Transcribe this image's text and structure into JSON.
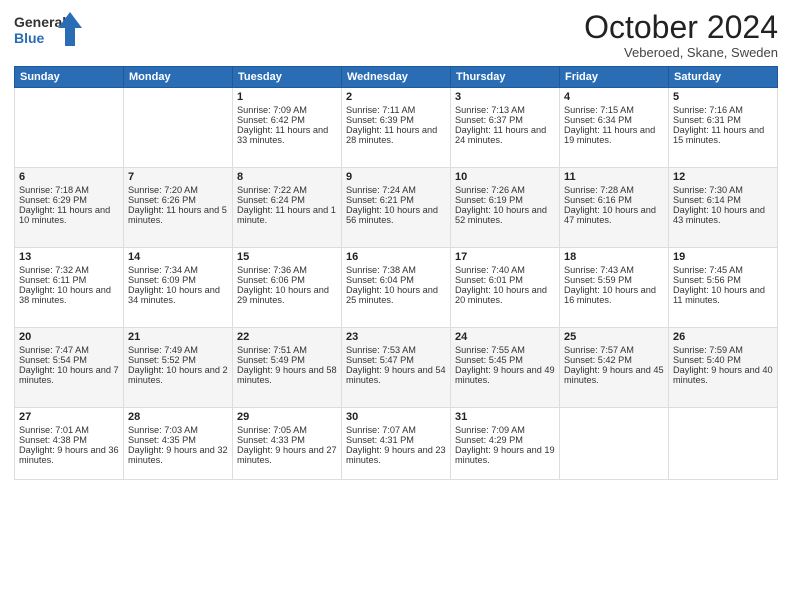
{
  "header": {
    "logo_general": "General",
    "logo_blue": "Blue",
    "month_title": "October 2024",
    "location": "Veberoed, Skane, Sweden"
  },
  "days_of_week": [
    "Sunday",
    "Monday",
    "Tuesday",
    "Wednesday",
    "Thursday",
    "Friday",
    "Saturday"
  ],
  "weeks": [
    [
      {
        "day": "",
        "sunrise": "",
        "sunset": "",
        "daylight": ""
      },
      {
        "day": "",
        "sunrise": "",
        "sunset": "",
        "daylight": ""
      },
      {
        "day": "1",
        "sunrise": "Sunrise: 7:09 AM",
        "sunset": "Sunset: 6:42 PM",
        "daylight": "Daylight: 11 hours and 33 minutes."
      },
      {
        "day": "2",
        "sunrise": "Sunrise: 7:11 AM",
        "sunset": "Sunset: 6:39 PM",
        "daylight": "Daylight: 11 hours and 28 minutes."
      },
      {
        "day": "3",
        "sunrise": "Sunrise: 7:13 AM",
        "sunset": "Sunset: 6:37 PM",
        "daylight": "Daylight: 11 hours and 24 minutes."
      },
      {
        "day": "4",
        "sunrise": "Sunrise: 7:15 AM",
        "sunset": "Sunset: 6:34 PM",
        "daylight": "Daylight: 11 hours and 19 minutes."
      },
      {
        "day": "5",
        "sunrise": "Sunrise: 7:16 AM",
        "sunset": "Sunset: 6:31 PM",
        "daylight": "Daylight: 11 hours and 15 minutes."
      }
    ],
    [
      {
        "day": "6",
        "sunrise": "Sunrise: 7:18 AM",
        "sunset": "Sunset: 6:29 PM",
        "daylight": "Daylight: 11 hours and 10 minutes."
      },
      {
        "day": "7",
        "sunrise": "Sunrise: 7:20 AM",
        "sunset": "Sunset: 6:26 PM",
        "daylight": "Daylight: 11 hours and 5 minutes."
      },
      {
        "day": "8",
        "sunrise": "Sunrise: 7:22 AM",
        "sunset": "Sunset: 6:24 PM",
        "daylight": "Daylight: 11 hours and 1 minute."
      },
      {
        "day": "9",
        "sunrise": "Sunrise: 7:24 AM",
        "sunset": "Sunset: 6:21 PM",
        "daylight": "Daylight: 10 hours and 56 minutes."
      },
      {
        "day": "10",
        "sunrise": "Sunrise: 7:26 AM",
        "sunset": "Sunset: 6:19 PM",
        "daylight": "Daylight: 10 hours and 52 minutes."
      },
      {
        "day": "11",
        "sunrise": "Sunrise: 7:28 AM",
        "sunset": "Sunset: 6:16 PM",
        "daylight": "Daylight: 10 hours and 47 minutes."
      },
      {
        "day": "12",
        "sunrise": "Sunrise: 7:30 AM",
        "sunset": "Sunset: 6:14 PM",
        "daylight": "Daylight: 10 hours and 43 minutes."
      }
    ],
    [
      {
        "day": "13",
        "sunrise": "Sunrise: 7:32 AM",
        "sunset": "Sunset: 6:11 PM",
        "daylight": "Daylight: 10 hours and 38 minutes."
      },
      {
        "day": "14",
        "sunrise": "Sunrise: 7:34 AM",
        "sunset": "Sunset: 6:09 PM",
        "daylight": "Daylight: 10 hours and 34 minutes."
      },
      {
        "day": "15",
        "sunrise": "Sunrise: 7:36 AM",
        "sunset": "Sunset: 6:06 PM",
        "daylight": "Daylight: 10 hours and 29 minutes."
      },
      {
        "day": "16",
        "sunrise": "Sunrise: 7:38 AM",
        "sunset": "Sunset: 6:04 PM",
        "daylight": "Daylight: 10 hours and 25 minutes."
      },
      {
        "day": "17",
        "sunrise": "Sunrise: 7:40 AM",
        "sunset": "Sunset: 6:01 PM",
        "daylight": "Daylight: 10 hours and 20 minutes."
      },
      {
        "day": "18",
        "sunrise": "Sunrise: 7:43 AM",
        "sunset": "Sunset: 5:59 PM",
        "daylight": "Daylight: 10 hours and 16 minutes."
      },
      {
        "day": "19",
        "sunrise": "Sunrise: 7:45 AM",
        "sunset": "Sunset: 5:56 PM",
        "daylight": "Daylight: 10 hours and 11 minutes."
      }
    ],
    [
      {
        "day": "20",
        "sunrise": "Sunrise: 7:47 AM",
        "sunset": "Sunset: 5:54 PM",
        "daylight": "Daylight: 10 hours and 7 minutes."
      },
      {
        "day": "21",
        "sunrise": "Sunrise: 7:49 AM",
        "sunset": "Sunset: 5:52 PM",
        "daylight": "Daylight: 10 hours and 2 minutes."
      },
      {
        "day": "22",
        "sunrise": "Sunrise: 7:51 AM",
        "sunset": "Sunset: 5:49 PM",
        "daylight": "Daylight: 9 hours and 58 minutes."
      },
      {
        "day": "23",
        "sunrise": "Sunrise: 7:53 AM",
        "sunset": "Sunset: 5:47 PM",
        "daylight": "Daylight: 9 hours and 54 minutes."
      },
      {
        "day": "24",
        "sunrise": "Sunrise: 7:55 AM",
        "sunset": "Sunset: 5:45 PM",
        "daylight": "Daylight: 9 hours and 49 minutes."
      },
      {
        "day": "25",
        "sunrise": "Sunrise: 7:57 AM",
        "sunset": "Sunset: 5:42 PM",
        "daylight": "Daylight: 9 hours and 45 minutes."
      },
      {
        "day": "26",
        "sunrise": "Sunrise: 7:59 AM",
        "sunset": "Sunset: 5:40 PM",
        "daylight": "Daylight: 9 hours and 40 minutes."
      }
    ],
    [
      {
        "day": "27",
        "sunrise": "Sunrise: 7:01 AM",
        "sunset": "Sunset: 4:38 PM",
        "daylight": "Daylight: 9 hours and 36 minutes."
      },
      {
        "day": "28",
        "sunrise": "Sunrise: 7:03 AM",
        "sunset": "Sunset: 4:35 PM",
        "daylight": "Daylight: 9 hours and 32 minutes."
      },
      {
        "day": "29",
        "sunrise": "Sunrise: 7:05 AM",
        "sunset": "Sunset: 4:33 PM",
        "daylight": "Daylight: 9 hours and 27 minutes."
      },
      {
        "day": "30",
        "sunrise": "Sunrise: 7:07 AM",
        "sunset": "Sunset: 4:31 PM",
        "daylight": "Daylight: 9 hours and 23 minutes."
      },
      {
        "day": "31",
        "sunrise": "Sunrise: 7:09 AM",
        "sunset": "Sunset: 4:29 PM",
        "daylight": "Daylight: 9 hours and 19 minutes."
      },
      {
        "day": "",
        "sunrise": "",
        "sunset": "",
        "daylight": ""
      },
      {
        "day": "",
        "sunrise": "",
        "sunset": "",
        "daylight": ""
      }
    ]
  ]
}
